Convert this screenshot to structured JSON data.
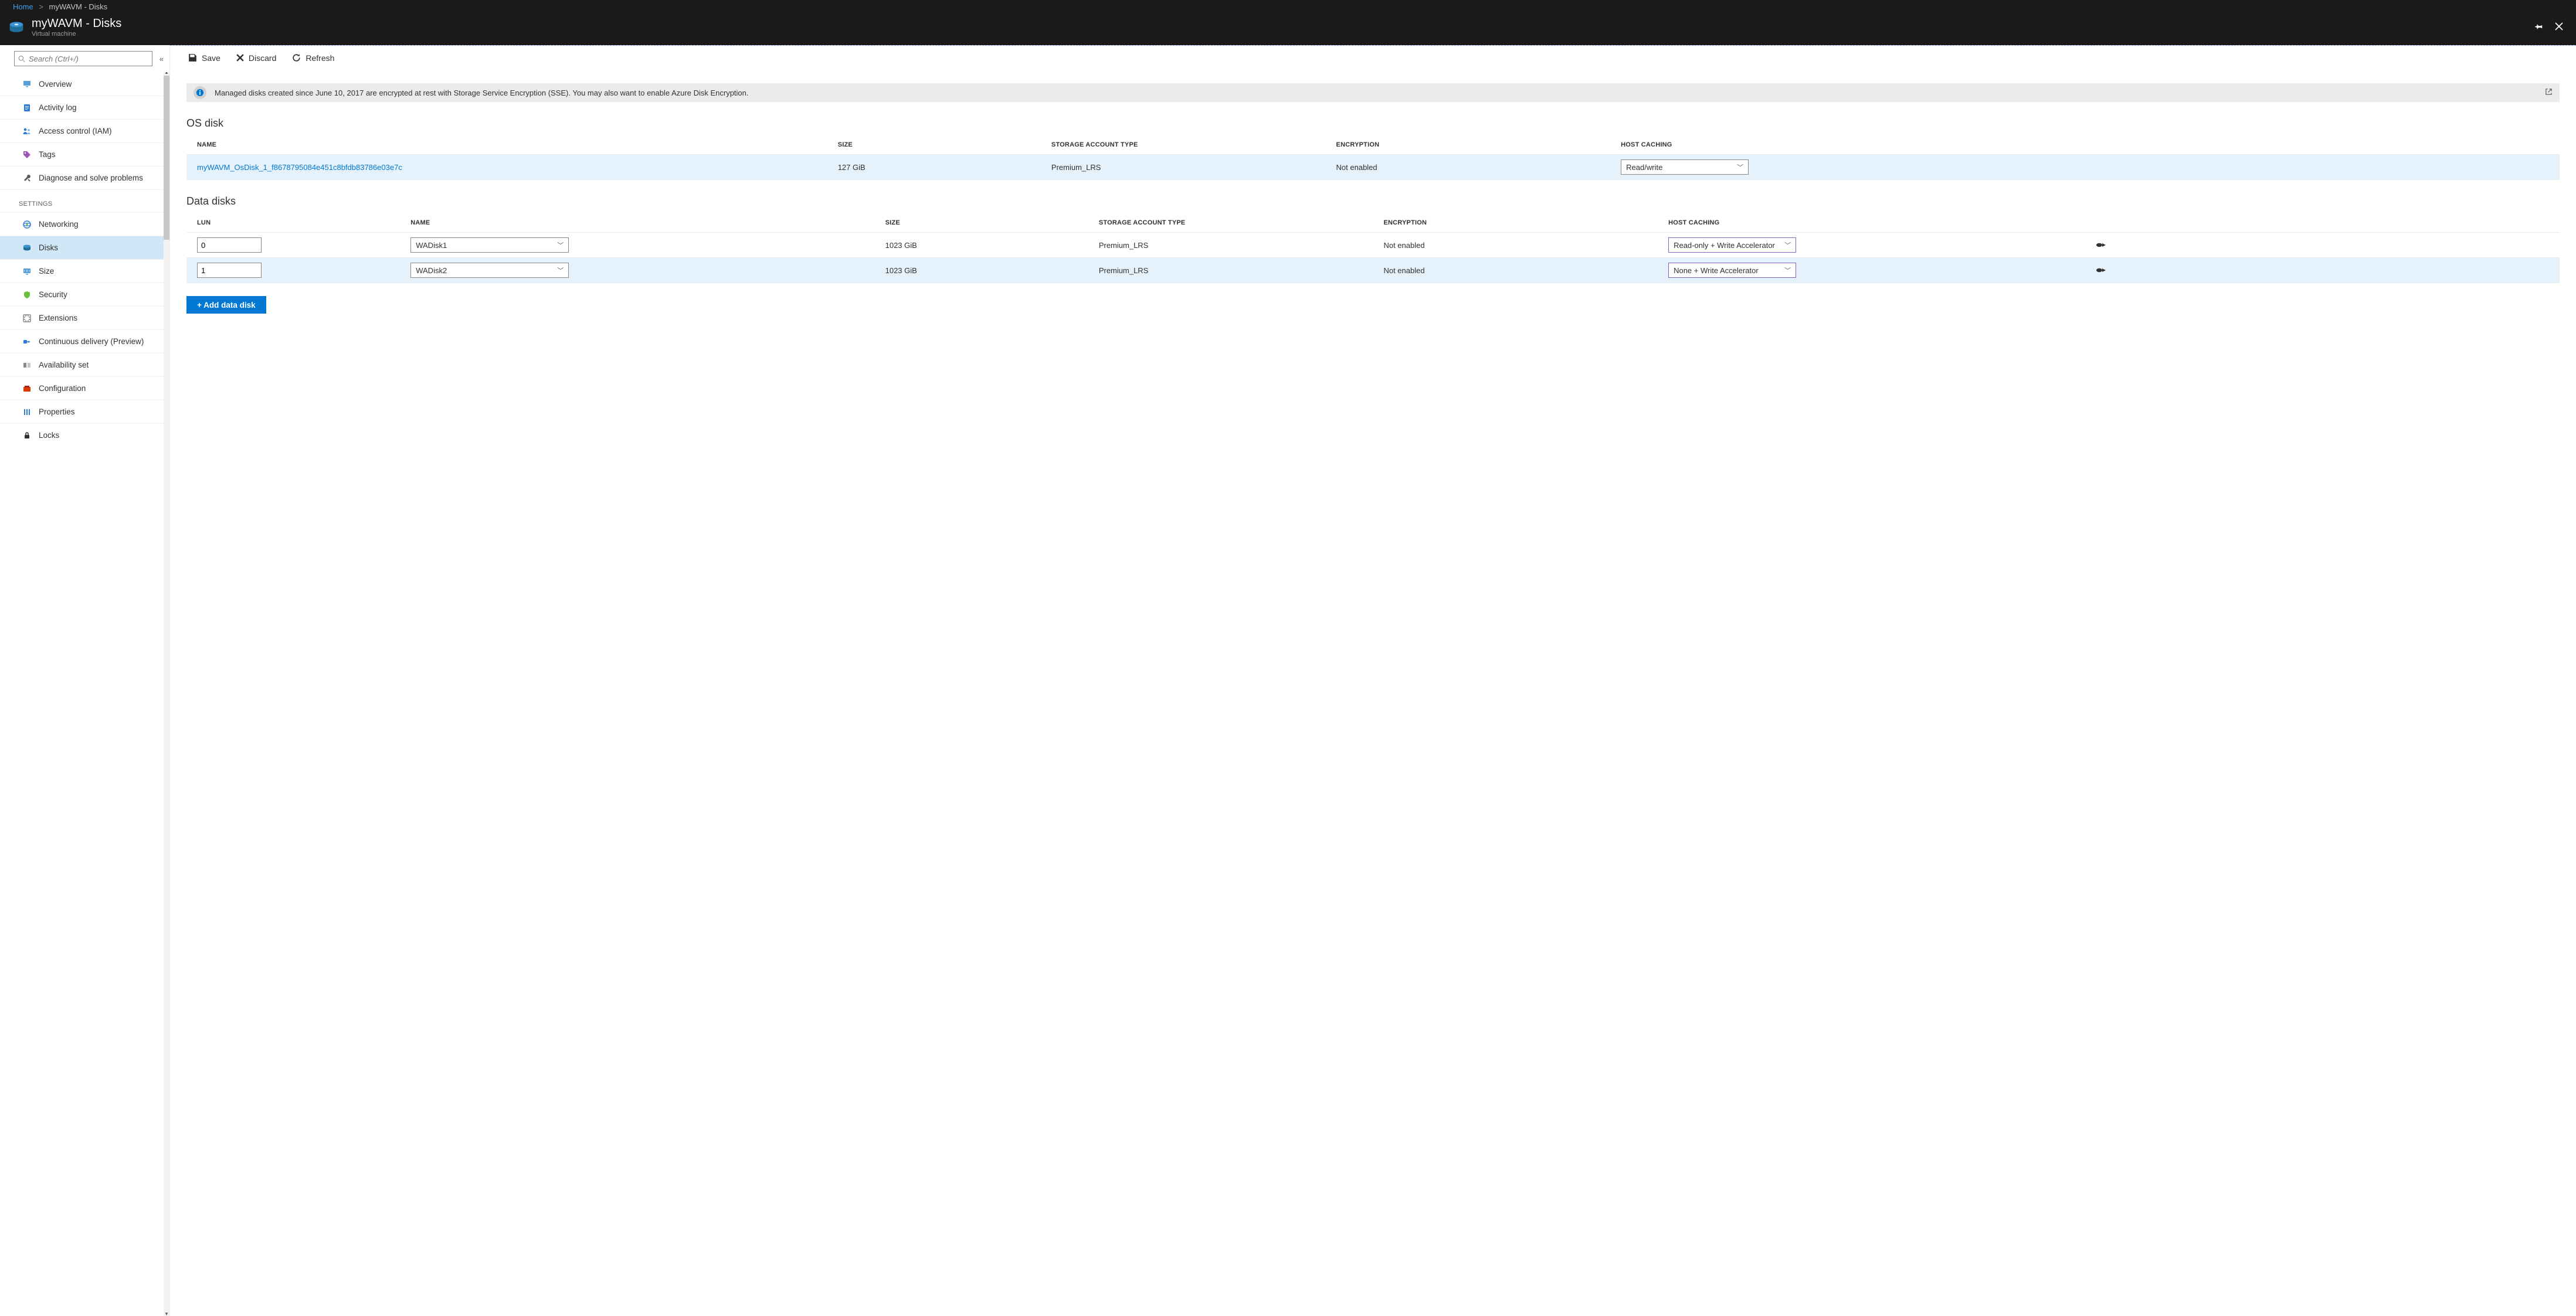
{
  "breadcrumb": {
    "home": "Home",
    "current": "myWAVM - Disks"
  },
  "title": "myWAVM - Disks",
  "subtitle": "Virtual machine",
  "search_placeholder": "Search (Ctrl+/)",
  "sidebar": {
    "items_top": [
      {
        "label": "Overview",
        "icon": "monitor"
      },
      {
        "label": "Activity log",
        "icon": "log"
      },
      {
        "label": "Access control (IAM)",
        "icon": "iam"
      },
      {
        "label": "Tags",
        "icon": "tag"
      },
      {
        "label": "Diagnose and solve problems",
        "icon": "wrench"
      }
    ],
    "section_label": "SETTINGS",
    "items_settings": [
      {
        "label": "Networking",
        "icon": "net"
      },
      {
        "label": "Disks",
        "icon": "disks",
        "selected": true
      },
      {
        "label": "Size",
        "icon": "size"
      },
      {
        "label": "Security",
        "icon": "shield"
      },
      {
        "label": "Extensions",
        "icon": "ext"
      },
      {
        "label": "Continuous delivery (Preview)",
        "icon": "cd"
      },
      {
        "label": "Availability set",
        "icon": "avail"
      },
      {
        "label": "Configuration",
        "icon": "config"
      },
      {
        "label": "Properties",
        "icon": "props"
      },
      {
        "label": "Locks",
        "icon": "lock"
      }
    ]
  },
  "toolbar": {
    "save": "Save",
    "discard": "Discard",
    "refresh": "Refresh"
  },
  "banner": "Managed disks created since June 10, 2017 are encrypted at rest with Storage Service Encryption (SSE). You may also want to enable Azure Disk Encryption.",
  "os_section": "OS disk",
  "data_section": "Data disks",
  "headers": {
    "name": "NAME",
    "size": "SIZE",
    "storage": "STORAGE ACCOUNT TYPE",
    "encryption": "ENCRYPTION",
    "caching": "HOST CACHING",
    "lun": "LUN"
  },
  "os_disk": {
    "name": "myWAVM_OsDisk_1_f8678795084e451c8bfdb83786e03e7c",
    "size": "127 GiB",
    "storage": "Premium_LRS",
    "encryption": "Not enabled",
    "caching": "Read/write"
  },
  "data_disks": [
    {
      "lun": "0",
      "name": "WADisk1",
      "size": "1023 GiB",
      "storage": "Premium_LRS",
      "encryption": "Not enabled",
      "caching": "Read-only + Write Accelerator"
    },
    {
      "lun": "1",
      "name": "WADisk2",
      "size": "1023 GiB",
      "storage": "Premium_LRS",
      "encryption": "Not enabled",
      "caching": "None + Write Accelerator"
    }
  ],
  "add_button": "+ Add data disk"
}
